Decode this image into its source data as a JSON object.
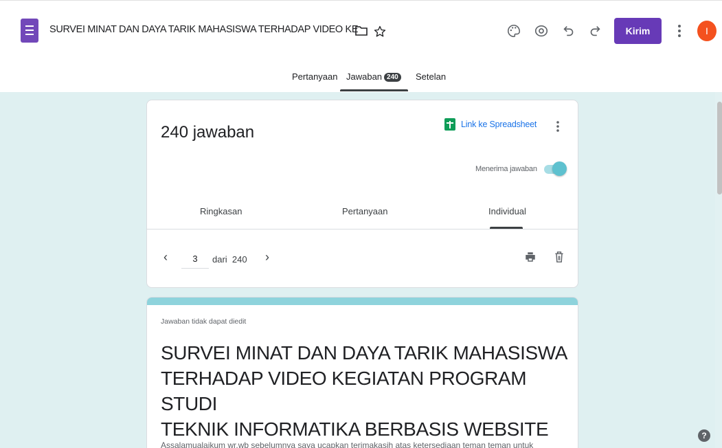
{
  "header": {
    "title": "SURVEI MINAT DAN DAYA TARIK MAHASISWA TERHADAP VIDEO KE",
    "send_label": "Kirim",
    "avatar_initial": "I",
    "accent_color": "#673ab7"
  },
  "tabs": [
    {
      "label": "Pertanyaan"
    },
    {
      "label": "Jawaban",
      "badge": "240",
      "active": true
    },
    {
      "label": "Setelan"
    }
  ],
  "summary": {
    "count_text": "240 jawaban",
    "sheets_link": "Link ke Spreadsheet",
    "accepting_label": "Menerima jawaban",
    "accepting": true,
    "sub_tabs": [
      "Ringkasan",
      "Pertanyaan",
      "Individual"
    ],
    "active_sub_tab": "Individual",
    "pager": {
      "current": "3",
      "of_label": "dari",
      "total": "240"
    }
  },
  "response": {
    "note": "Jawaban tidak dapat diedit",
    "title_lines": [
      "SURVEI MINAT DAN DAYA TARIK MAHASISWA",
      "TERHADAP VIDEO KEGIATAN PROGRAM STUDI",
      "TEKNIK INFORMATIKA BERBASIS WEBSITE"
    ],
    "description": "Assalamualaikum wr.wb sebelumnya saya ucapkan terimakasih atas ketersediaan teman teman untuk"
  },
  "icons": [
    "forms-logo-icon",
    "folder-icon",
    "star-icon",
    "palette-icon",
    "preview-eye-icon",
    "undo-icon",
    "redo-icon",
    "more-vert-icon",
    "sheets-icon",
    "chevron-left-icon",
    "chevron-right-icon",
    "print-icon",
    "delete-icon",
    "help-icon"
  ]
}
